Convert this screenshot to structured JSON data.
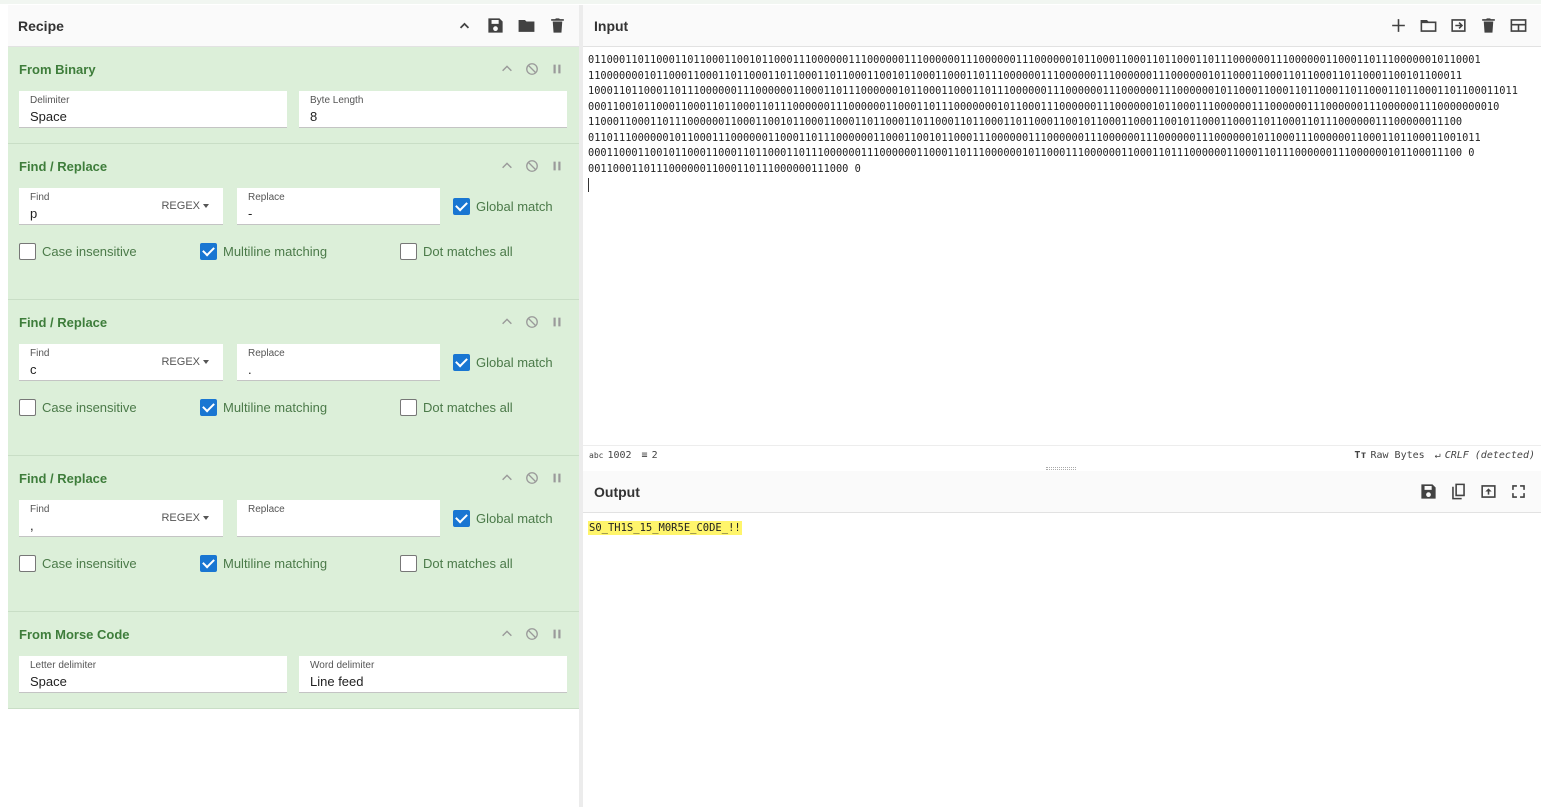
{
  "recipe": {
    "title": "Recipe",
    "operations": [
      {
        "title": "From Binary",
        "fields": [
          {
            "label": "Delimiter",
            "value": "Space"
          },
          {
            "label": "Byte Length",
            "value": "8"
          }
        ]
      },
      {
        "title": "Find / Replace",
        "find_label": "Find",
        "find_value": "p",
        "find_mode": "REGEX",
        "replace_label": "Replace",
        "replace_value": "-",
        "global": "Global match",
        "case": "Case insensitive",
        "multiline": "Multiline matching",
        "dotall": "Dot matches all"
      },
      {
        "title": "Find / Replace",
        "find_label": "Find",
        "find_value": "c",
        "find_mode": "REGEX",
        "replace_label": "Replace",
        "replace_value": ".",
        "global": "Global match",
        "case": "Case insensitive",
        "multiline": "Multiline matching",
        "dotall": "Dot matches all"
      },
      {
        "title": "Find / Replace",
        "find_label": "Find",
        "find_value": ",",
        "find_mode": "REGEX",
        "replace_label": "Replace",
        "replace_value": "",
        "global": "Global match",
        "case": "Case insensitive",
        "multiline": "Multiline matching",
        "dotall": "Dot matches all"
      },
      {
        "title": "From Morse Code",
        "fields": [
          {
            "label": "Letter delimiter",
            "value": "Space"
          },
          {
            "label": "Word delimiter",
            "value": "Line feed"
          }
        ]
      }
    ]
  },
  "input": {
    "title": "Input",
    "lines": [
      "011000110110001101100011001011000111000000111000000111000000111000000111000000101100011000110110001101110000001110000001100011011100000010110001",
      "110000000101100011000110110001101100011011000110010110001100011011100000011100000011100000011100000010110001100011011000110110001100101100011",
      "100011011000110111000000111000000110001101110000001011000110001101110000001110000001110000001110000001011000110001101100011011000110110001101100011011",
      "000110010110001100011011000110111000000111000000110001101110000000101100011100000011100000010110001110000001110000001110000001110000001110000000010",
      "110001100011011100000011000110010110001100011011000110110001101100011011000110010110001100011001011000110001101100011011100000011100000011100",
      "011011100000010110001110000001100011011100000011000110010110001110000001110000001110000001110000001110000001011000111000000110001101100011001011",
      "000110001100101100011000110110001101110000001110000001100011011100000010110001110000001100011011100000011000110111000000111000000101100011100 0",
      "001100011011100000011000110111000000111000 0"
    ],
    "stats": {
      "length": "1002",
      "lines": "2",
      "encoding": "Raw Bytes",
      "eol": "CRLF (detected)"
    }
  },
  "output": {
    "title": "Output",
    "text": "S0_TH1S_15_M0R5E_C0DE_!!"
  }
}
